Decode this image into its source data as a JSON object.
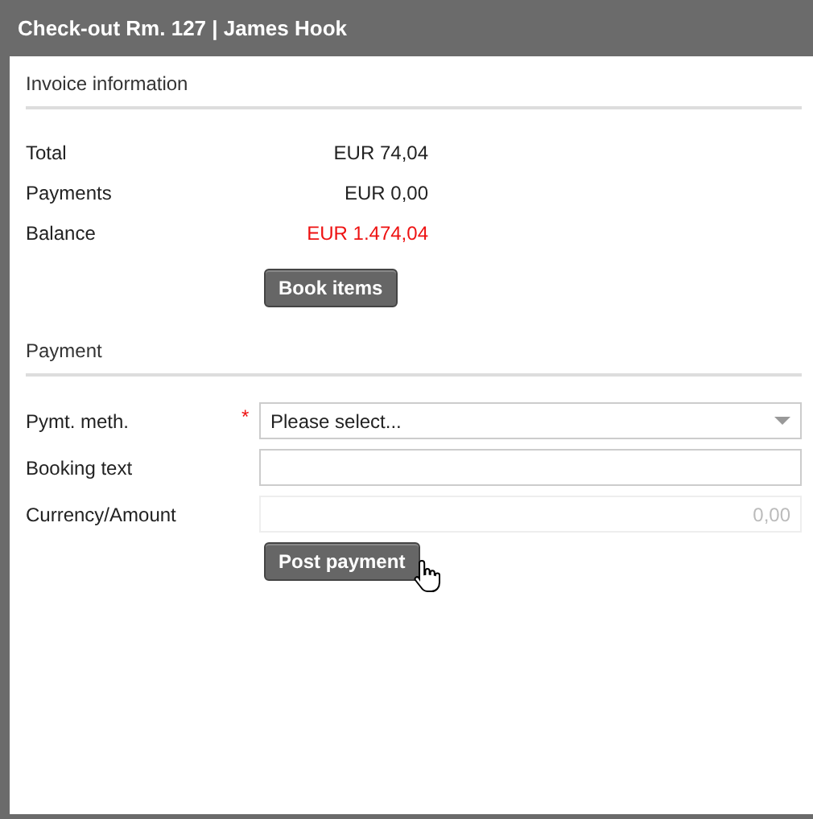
{
  "window": {
    "title": "Check-out Rm. 127 | James Hook"
  },
  "invoice": {
    "heading": "Invoice information",
    "rows": [
      {
        "label": "Total",
        "value": "EUR 74,04",
        "alert": false
      },
      {
        "label": "Payments",
        "value": "EUR 0,00",
        "alert": false
      },
      {
        "label": "Balance",
        "value": "EUR 1.474,04",
        "alert": true
      }
    ],
    "button": "Book items"
  },
  "payment": {
    "heading": "Payment",
    "fields": [
      {
        "kind": "select",
        "label": "Pymt. meth.",
        "required": true,
        "required_mark": "*",
        "value": "Please select..."
      },
      {
        "kind": "text",
        "label": "Booking text",
        "required": false
      },
      {
        "kind": "amount",
        "label": "Currency/Amount",
        "required": false,
        "value": "0,00",
        "disabled": true
      }
    ],
    "button": "Post payment"
  }
}
